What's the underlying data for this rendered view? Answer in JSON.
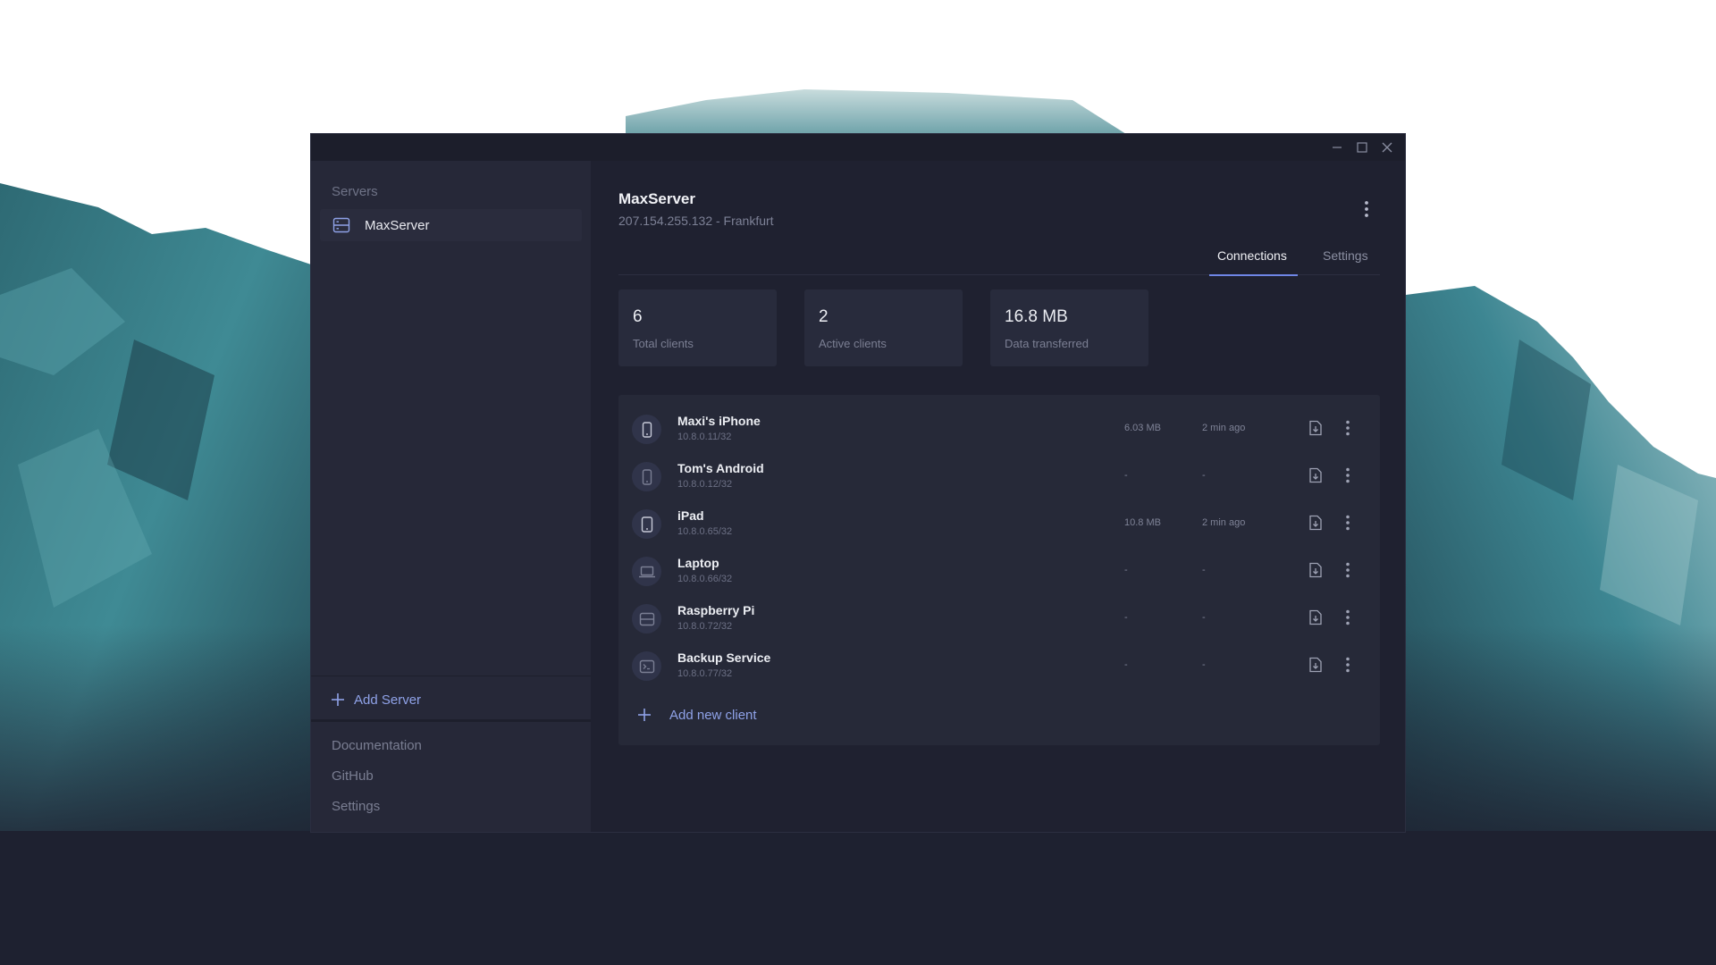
{
  "window": {
    "controls": {
      "minimize_icon": "minimize-icon",
      "maximize_icon": "maximize-icon",
      "close_icon": "close-icon"
    }
  },
  "sidebar": {
    "heading": "Servers",
    "servers": [
      {
        "label": "MaxServer",
        "icon": "server-icon"
      }
    ],
    "add_server_label": "Add Server",
    "footer_links": [
      "Documentation",
      "GitHub",
      "Settings"
    ]
  },
  "main": {
    "server_name": "MaxServer",
    "server_subtitle": "207.154.255.132 - Frankfurt",
    "tabs": [
      {
        "label": "Connections",
        "active": true
      },
      {
        "label": "Settings",
        "active": false
      }
    ],
    "stats": [
      {
        "value": "6",
        "label": "Total clients"
      },
      {
        "value": "2",
        "label": "Active clients"
      },
      {
        "value": "16.8 MB",
        "label": "Data transferred"
      }
    ],
    "clients": [
      {
        "name": "Maxi's iPhone",
        "ip": "10.8.0.11/32",
        "data": "6.03 MB",
        "last_seen": "2 min ago",
        "icon": "phone-icon"
      },
      {
        "name": "Tom's Android",
        "ip": "10.8.0.12/32",
        "data": "-",
        "last_seen": "-",
        "icon": "phone-icon"
      },
      {
        "name": "iPad",
        "ip": "10.8.0.65/32",
        "data": "10.8 MB",
        "last_seen": "2 min ago",
        "icon": "tablet-icon"
      },
      {
        "name": "Laptop",
        "ip": "10.8.0.66/32",
        "data": "-",
        "last_seen": "-",
        "icon": "laptop-icon"
      },
      {
        "name": "Raspberry Pi",
        "ip": "10.8.0.72/32",
        "data": "-",
        "last_seen": "-",
        "icon": "server-icon"
      },
      {
        "name": "Backup Service",
        "ip": "10.8.0.77/32",
        "data": "-",
        "last_seen": "-",
        "icon": "terminal-icon"
      }
    ],
    "add_client_label": "Add new client"
  },
  "colors": {
    "accent": "#8fa2e8",
    "tab_underline": "#6f86e6",
    "window_bg": "#1f2130",
    "sidebar_bg": "#262838",
    "card_bg": "#282b3c"
  }
}
